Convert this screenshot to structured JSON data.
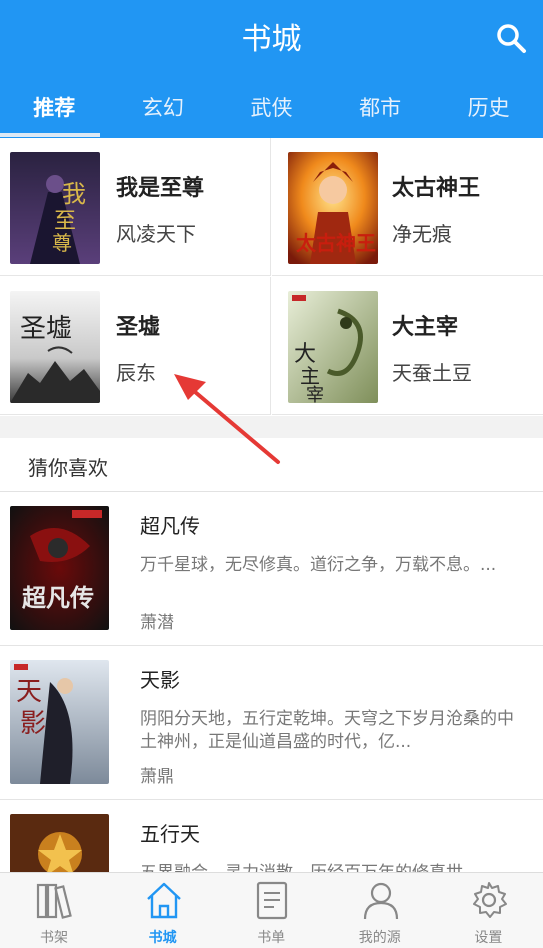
{
  "header": {
    "title": "书城"
  },
  "tabs": [
    {
      "label": "推荐",
      "active": true
    },
    {
      "label": "玄幻",
      "active": false
    },
    {
      "label": "武侠",
      "active": false
    },
    {
      "label": "都市",
      "active": false
    },
    {
      "label": "历史",
      "active": false
    }
  ],
  "featured": [
    {
      "title": "我是至尊",
      "author": "风凌天下"
    },
    {
      "title": "太古神王",
      "author": "净无痕"
    },
    {
      "title": "圣墟",
      "author": "辰东"
    },
    {
      "title": "大主宰",
      "author": "天蚕土豆"
    }
  ],
  "recommend": {
    "title": "猜你喜欢",
    "books": [
      {
        "title": "超凡传",
        "desc": "万千星球，无尽修真。道衍之争，万载不息。...",
        "author": "萧潜"
      },
      {
        "title": "天影",
        "desc": "阴阳分天地，五行定乾坤。天穹之下岁月沧桑的中土神州，正是仙道昌盛的时代，亿...",
        "author": "萧鼎"
      },
      {
        "title": "五行天",
        "desc": "五界融合，灵力消散，历经百万年的修真世",
        "author": ""
      }
    ]
  },
  "bottom_nav": [
    {
      "label": "书架",
      "icon": "bookshelf-icon",
      "active": false
    },
    {
      "label": "书城",
      "icon": "home-icon",
      "active": true
    },
    {
      "label": "书单",
      "icon": "document-icon",
      "active": false
    },
    {
      "label": "我的源",
      "icon": "person-icon",
      "active": false
    },
    {
      "label": "设置",
      "icon": "gear-icon",
      "active": false
    }
  ],
  "colors": {
    "primary": "#2196F3",
    "annotation_arrow": "#e53935"
  }
}
